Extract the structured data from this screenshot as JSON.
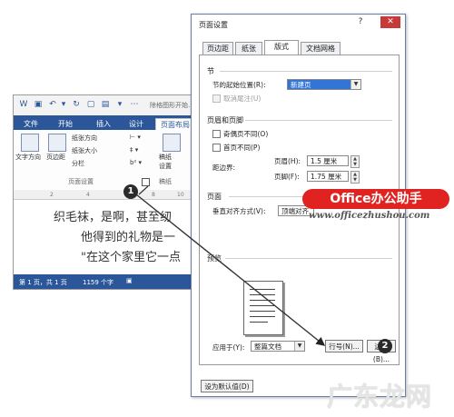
{
  "word": {
    "doc_title": "除格图形开始…",
    "tabs": [
      "文件",
      "开始",
      "插入",
      "设计",
      "页面布局"
    ],
    "ribbon": {
      "text_direction": "文字方向",
      "margins": "页边距",
      "orientation": "纸张方向",
      "size": "纸张大小",
      "columns": "分栏",
      "draft": "稿纸",
      "draft_setting": "设置",
      "group_page_setup": "页面设置",
      "group_draft": "稿纸"
    },
    "ruler_ticks": [
      "2",
      "4",
      "8",
      "10"
    ],
    "body_lines": [
      "织毛袜，是啊，甚至纫",
      "他得到的礼物是一",
      "\"在这个家里它一点"
    ],
    "status": {
      "page": "第 1 页，共 1 页",
      "words": "1159 个字"
    }
  },
  "dialog": {
    "title": "页面设置",
    "tabs": [
      "页边距",
      "纸张",
      "版式",
      "文档网格"
    ],
    "section_heading": "节",
    "section_start_label": "节的起始位置(R):",
    "section_start_value": "新建页",
    "cancel_endnotes": "取消尾注(U)",
    "header_footer_heading": "页眉和页脚",
    "odd_even": "奇偶页不同(O)",
    "first_page": "首页不同(P)",
    "from_edge_label": "距边界:",
    "header_label": "页眉(H):",
    "header_value": "1.5 厘米",
    "footer_label": "页脚(F):",
    "footer_value": "1.75 厘米",
    "page_heading": "页面",
    "vertical_align_label": "垂直对齐方式(V):",
    "vertical_align_value": "顶端对齐",
    "preview_heading": "预览",
    "apply_to_label": "应用于(Y):",
    "apply_to_value": "整篇文档",
    "line_numbers_button": "行号(N)...",
    "borders_button": "边框(B)...",
    "set_default_button": "设为默认值(D)"
  },
  "callouts": [
    "1",
    "2"
  ],
  "watermark": {
    "badge": "Office办公助手",
    "url": "www.officezhushou.com",
    "logo": "广东龙网"
  }
}
